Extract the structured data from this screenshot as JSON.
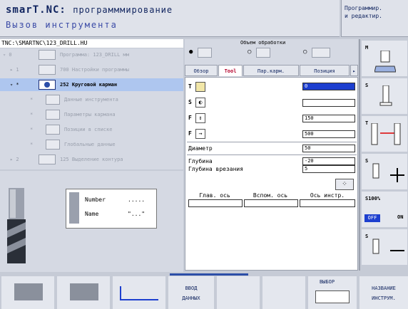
{
  "header": {
    "title": "smarT.NC:",
    "title_sub": "программмирование",
    "subtitle": "Вызов инструмента",
    "mode_line1": "Программир.",
    "mode_line2": "и редактир."
  },
  "tree": {
    "path": "TNC:\\SMARTNC\\123_DRILL.HU",
    "rows": [
      {
        "mark": "▿ 0",
        "num": "",
        "label": "Программа: 123_DRILL мм"
      },
      {
        "mark": "▸ 1",
        "num": "700",
        "label": "Настройки программы"
      },
      {
        "mark": "▿ *",
        "num": "252",
        "label": "Круговой карман"
      },
      {
        "mark": "*",
        "num": "",
        "label": "Данные инструмента"
      },
      {
        "mark": "*",
        "num": "",
        "label": "Параметры кармана"
      },
      {
        "mark": "*",
        "num": "",
        "label": "Позиции в списке"
      },
      {
        "mark": "*",
        "num": "",
        "label": "Глобальные данные"
      },
      {
        "mark": "▸ 2",
        "num": "125",
        "label": "Выделение контура"
      }
    ]
  },
  "preview": {
    "number_label": "Number",
    "number_value": ".....",
    "name_label": "Name",
    "name_value": "\"...\""
  },
  "form": {
    "scope_label": "Объем обработки",
    "tabs": [
      "Обзор",
      "Tool",
      "Пар.карм.",
      "Позиция"
    ],
    "t_value": "0",
    "s_value": "",
    "f_value": "150",
    "f2_value": "500",
    "diameter_label": "Диаметр",
    "diameter_value": "50",
    "depth_label": "Глубина",
    "depth_value": "-20",
    "feed_depth_label": "Глубина врезания",
    "feed_depth_value": "5",
    "axis_headers": [
      "Глав. ось",
      "Вспом. ось",
      "Ось инстр."
    ]
  },
  "side_keys": {
    "m": "M",
    "s1": "S",
    "t": "T",
    "s2": "S",
    "s100": "S100%",
    "off": "OFF",
    "on": "ON",
    "s3": "S"
  },
  "softkeys": {
    "input_line1": "ВВОД",
    "input_line2": "ДАННЫХ",
    "select": "ВЫБОР",
    "name_line1": "НАЗВАНИЕ",
    "name_line2": "ИНСТРУМ."
  }
}
